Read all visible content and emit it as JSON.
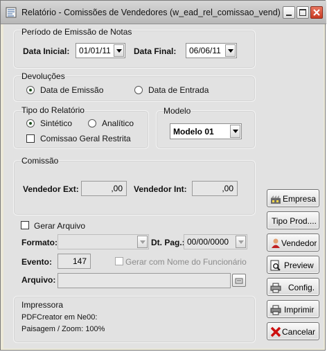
{
  "window": {
    "title": "Relatório - Comissões de Vendedores (w_ead_rel_comissao_vend)"
  },
  "periodo": {
    "heading": "Período de Emissão de Notas",
    "data_inicial_label": "Data Inicial:",
    "data_inicial_value": "01/01/11",
    "data_final_label": "Data Final:",
    "data_final_value": "06/06/11"
  },
  "devolucoes": {
    "heading": "Devoluções",
    "option_emissao": "Data de Emissão",
    "option_entrada": "Data de Entrada",
    "selected": "emissao"
  },
  "tipo": {
    "heading": "Tipo do Relatório",
    "option_sintetico": "Sintético",
    "option_analitico": "Analítico",
    "selected": "sintetico",
    "comissao_geral_label": "Comissao Geral Restrita",
    "comissao_geral_checked": false
  },
  "modelo": {
    "heading": "Modelo",
    "value": "Modelo 01"
  },
  "comissao": {
    "heading": "Comissão",
    "vendedor_ext_label": "Vendedor Ext:",
    "vendedor_ext_value": ",00",
    "vendedor_int_label": "Vendedor Int:",
    "vendedor_int_value": ",00"
  },
  "arquivo": {
    "gerar_label": "Gerar Arquivo",
    "gerar_checked": false,
    "formato_label": "Formato:",
    "formato_value": "",
    "dt_pag_label": "Dt. Pag.:",
    "dt_pag_value": "00/00/0000",
    "evento_label": "Evento:",
    "evento_value": "147",
    "gerar_nome_label": "Gerar com Nome do Funcionário",
    "gerar_nome_checked": false,
    "arquivo_label": "Arquivo:",
    "arquivo_value": ""
  },
  "impressora": {
    "heading": "Impressora",
    "printer": "PDFCreator em Ne00:",
    "paisagem": "Paisagem / Zoom: 100%"
  },
  "buttons": {
    "empresa": "Empresa",
    "tipo_prod": "Tipo Prod....",
    "vendedor": "Vendedor",
    "preview": "Preview",
    "config": "Config.",
    "imprimir": "Imprimir",
    "cancelar": "Cancelar"
  },
  "icons": {
    "app": "report-icon",
    "minimize": "minimize-icon",
    "maximize": "maximize-icon",
    "close": "close-icon",
    "empresa": "factory-icon",
    "vendedor": "person-icon",
    "preview": "magnifier-document-icon",
    "config": "printer-config-icon",
    "imprimir": "printer-icon",
    "cancelar": "red-x-icon",
    "file_browse": "folder-icon"
  },
  "colors": {
    "close_button": "#d9402a",
    "cancel_x": "#cc1010",
    "window_bg": "#e2e2e2"
  }
}
